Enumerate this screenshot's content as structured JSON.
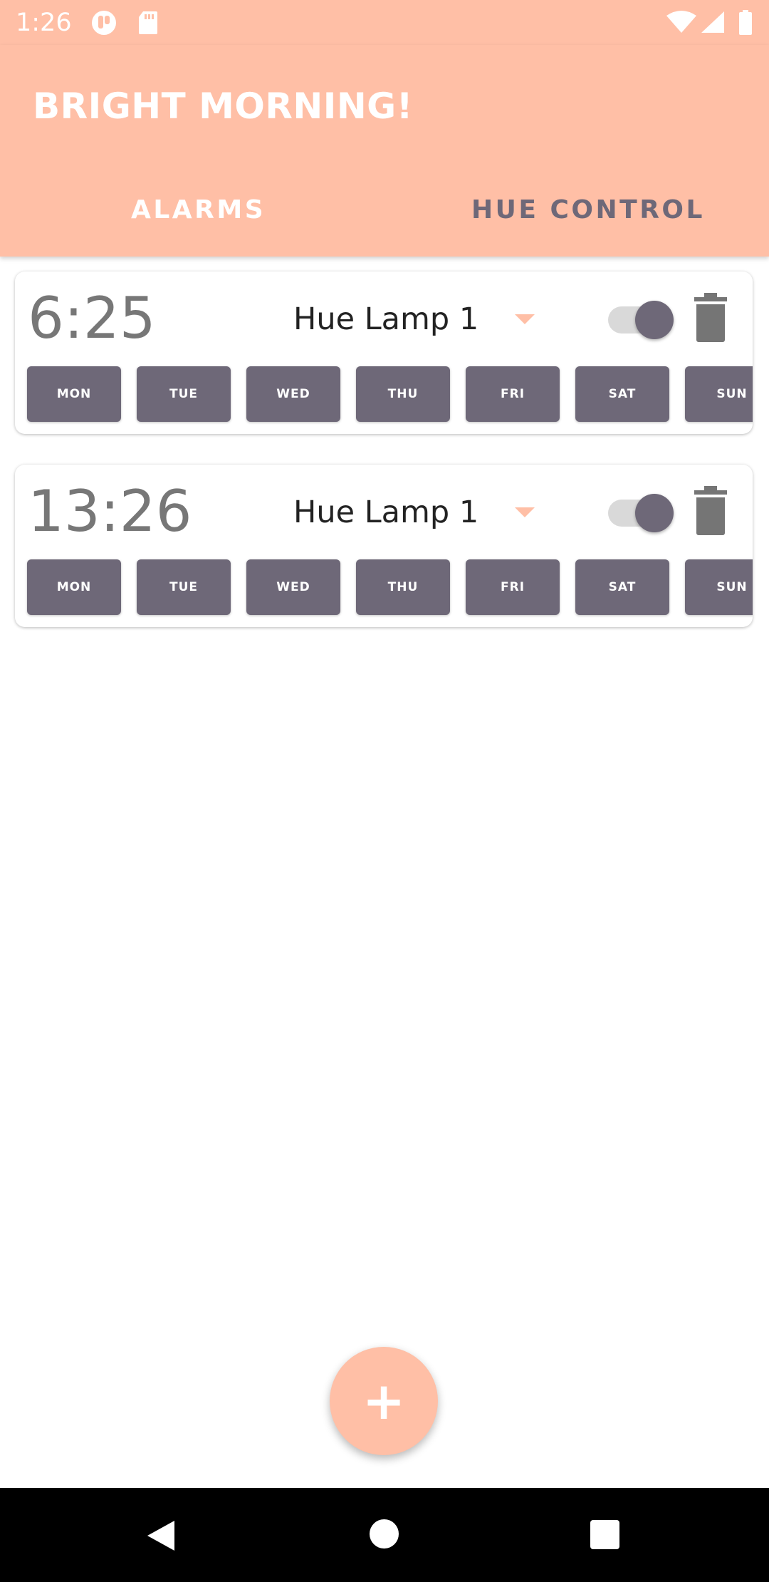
{
  "status_bar": {
    "time": "1:26",
    "icons": [
      "notification-icon",
      "sd-card-icon",
      "wifi-icon",
      "cellular-signal-icon",
      "battery-icon"
    ]
  },
  "app": {
    "title": "BRIGHT MORNING!",
    "tabs": [
      {
        "label": "ALARMS",
        "selected": true
      },
      {
        "label": "HUE CONTROL",
        "selected": false
      }
    ]
  },
  "alarms": [
    {
      "time": "6:25",
      "lamp": "Hue Lamp 1",
      "enabled": true,
      "days": [
        "MON",
        "TUE",
        "WED",
        "THU",
        "FRI",
        "SAT",
        "SUN"
      ]
    },
    {
      "time": "13:26",
      "lamp": "Hue Lamp 1",
      "enabled": true,
      "days": [
        "MON",
        "TUE",
        "WED",
        "THU",
        "FRI",
        "SAT",
        "SUN"
      ]
    }
  ],
  "fab": {
    "label": "+"
  },
  "colors": {
    "accent": "#ffbfa6",
    "day_button": "#6e6878",
    "text_muted": "#777777"
  }
}
